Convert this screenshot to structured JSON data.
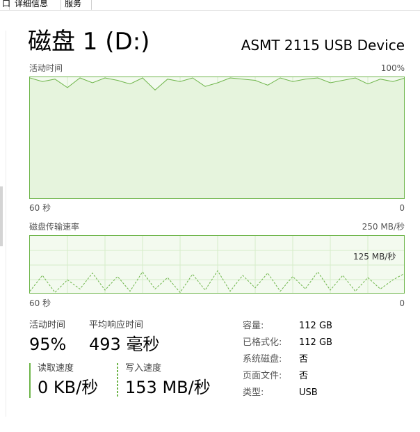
{
  "tabs": [
    {
      "label": "口"
    },
    {
      "label": "详细信息"
    },
    {
      "label": "服务"
    }
  ],
  "header": {
    "title": "磁盘 1 (D:)",
    "device": "ASMT 2115 USB Device"
  },
  "activity_chart": {
    "label": "活动时间",
    "max_label": "100%",
    "time_label": "60 秒",
    "zero_label": "0"
  },
  "transfer_chart": {
    "label": "磁盘传输速率",
    "max_label": "250 MB/秒",
    "mid_label": "125 MB/秒",
    "time_label": "60 秒",
    "zero_label": "0"
  },
  "stats": {
    "active_time_label": "活动时间",
    "active_time_value": "95%",
    "avg_response_label": "平均响应时间",
    "avg_response_value": "493 毫秒",
    "read_speed_label": "读取速度",
    "read_speed_value": "0 KB/秒",
    "write_speed_label": "写入速度",
    "write_speed_value": "153 MB/秒"
  },
  "properties": [
    {
      "label": "容量:",
      "value": "112 GB"
    },
    {
      "label": "已格式化:",
      "value": "112 GB"
    },
    {
      "label": "系统磁盘:",
      "value": "否"
    },
    {
      "label": "页面文件:",
      "value": "否"
    },
    {
      "label": "类型:",
      "value": "USB"
    }
  ],
  "chart_data": [
    {
      "type": "line",
      "title": "活动时间",
      "ylim": [
        0,
        100
      ],
      "x": [
        0,
        2,
        4,
        6,
        8,
        10,
        12,
        14,
        16,
        18,
        20,
        22,
        24,
        26,
        28,
        30,
        32,
        34,
        36,
        38,
        40,
        42,
        44,
        46,
        48,
        50,
        52,
        54,
        56,
        58,
        60
      ],
      "series": [
        {
          "values": [
            100,
            97,
            99,
            92,
            100,
            96,
            100,
            98,
            95,
            100,
            90,
            99,
            97,
            100,
            93,
            96,
            100,
            99,
            98,
            94,
            100,
            97,
            99,
            100,
            96,
            98,
            100,
            95,
            99,
            97,
            100
          ]
        }
      ],
      "grid": true
    },
    {
      "type": "line",
      "title": "磁盘传输速率",
      "ylim": [
        0,
        250
      ],
      "x": [
        0,
        2,
        4,
        6,
        8,
        10,
        12,
        14,
        16,
        18,
        20,
        22,
        24,
        26,
        28,
        30,
        32,
        34,
        36,
        38,
        40,
        42,
        44,
        46,
        48,
        50,
        52,
        54,
        56,
        58,
        60
      ],
      "series": [
        {
          "values": [
            10,
            80,
            5,
            60,
            20,
            90,
            15,
            75,
            10,
            95,
            20,
            70,
            5,
            85,
            15,
            100,
            10,
            80,
            25,
            90,
            10,
            75,
            20,
            95,
            15,
            80,
            10,
            70,
            20,
            60,
            90
          ]
        }
      ],
      "grid": true
    }
  ],
  "colors": {
    "accent": "#6eb54a",
    "chart_bg": "#f3faef"
  }
}
